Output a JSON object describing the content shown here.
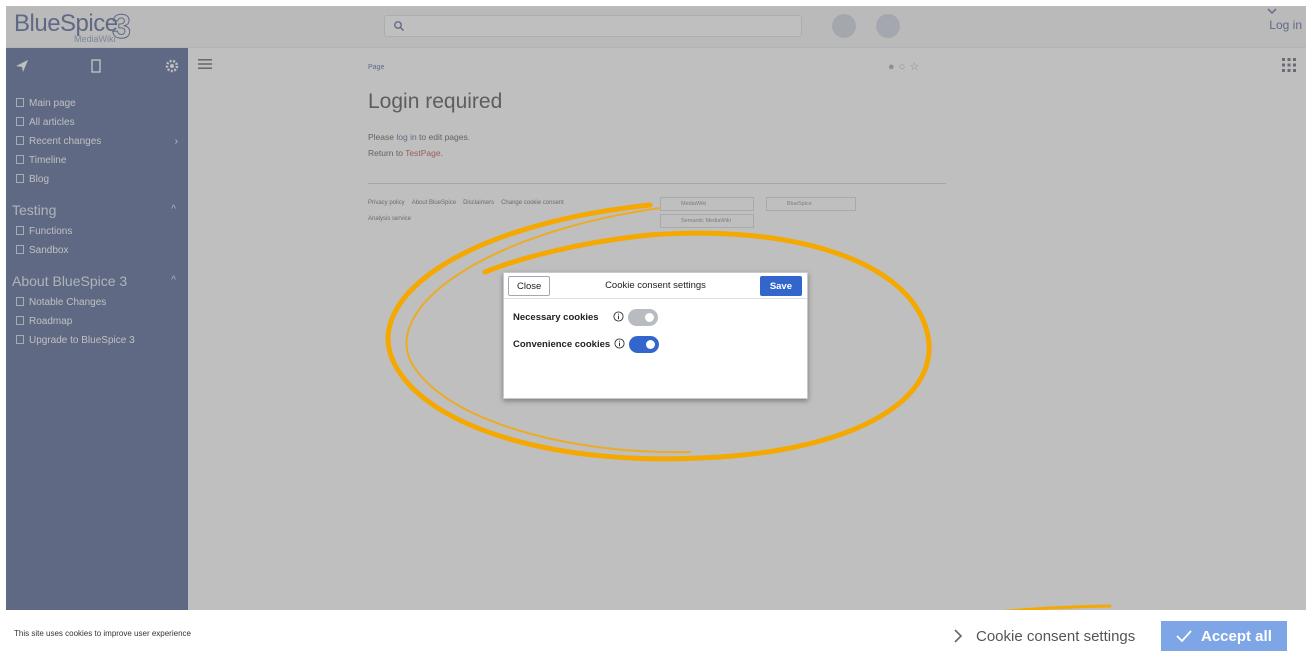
{
  "topbar": {
    "logo_main": "BlueSpice",
    "logo_version": "3",
    "logo_sub": "MediaWiki",
    "login": "Log in"
  },
  "sidebar": {
    "items": [
      {
        "label": "Main page",
        "icon": "home-icon"
      },
      {
        "label": "All articles",
        "icon": "page-icon"
      },
      {
        "label": "Recent changes",
        "icon": "clock-icon"
      },
      {
        "label": "Timeline",
        "icon": "page-icon"
      },
      {
        "label": "Blog",
        "icon": "page-icon"
      }
    ],
    "section_testing": "Testing",
    "testing_items": [
      "Functions",
      "Sandbox"
    ],
    "section_about": "About BlueSpice 3",
    "about_items": [
      "Notable Changes",
      "Roadmap",
      "Upgrade to BlueSpice 3"
    ]
  },
  "content": {
    "breadcrumb": "Page",
    "title": "Login required",
    "msg1_pre": "Please ",
    "msg1_link": "log in",
    "msg1_post": " to edit pages.",
    "msg2_pre": "Return to ",
    "msg2_link": "TestPage",
    "msg2_post": ".",
    "footer_links": [
      "Privacy policy",
      "About BlueSpice",
      "Disclaimers",
      "Change cookie consent"
    ],
    "footer_link2": "Analysis service",
    "badge1": "MediaWiki",
    "badge2": "BlueSpice",
    "badge3": "Semantic MediaWiki"
  },
  "dialog": {
    "close_label": "Close",
    "title": "Cookie consent settings",
    "save_label": "Save",
    "necessary_label": "Necessary cookies",
    "necessary_enabled": true,
    "necessary_locked": true,
    "convenience_label": "Convenience cookies",
    "convenience_enabled": true
  },
  "cookie_bar": {
    "text": "This site uses cookies to improve user experience",
    "settings_label": "Cookie consent settings",
    "accept_label": "Accept all"
  },
  "colors": {
    "brand": "#3e5389",
    "primary": "#3366cc",
    "accept": "#7ea6e6",
    "annotation": "#f5a800"
  }
}
